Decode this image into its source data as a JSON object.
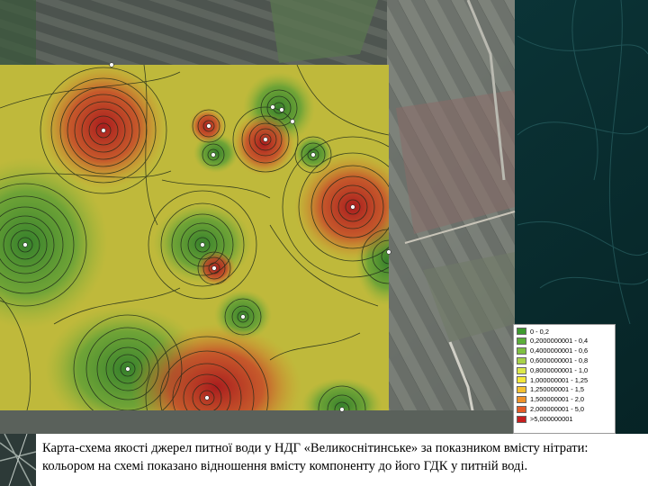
{
  "legend": {
    "items": [
      {
        "label": "0 - 0,2",
        "color": "#3e9b2f"
      },
      {
        "label": "0,2000000001 - 0,4",
        "color": "#5cae3a"
      },
      {
        "label": "0,4000000001 - 0,6",
        "color": "#7fc042"
      },
      {
        "label": "0,6000000001 - 0,8",
        "color": "#a8d24a"
      },
      {
        "label": "0,8000000001 - 1,0",
        "color": "#dce84c"
      },
      {
        "label": "1,000000001 - 1,25",
        "color": "#f5e83c"
      },
      {
        "label": "1,250000001 - 1,5",
        "color": "#f6c232"
      },
      {
        "label": "1,500000001 - 2,0",
        "color": "#f0922a"
      },
      {
        "label": "2,000000001 - 5,0",
        "color": "#e45a26"
      },
      {
        "label": ">5,000000001",
        "color": "#c61e1e"
      }
    ]
  },
  "caption": {
    "line1": "Карта-схема якості джерел питної води у НДГ «Великоснітинське» за показником вмісту нітрати:",
    "line2": "кольором на схемі показано відношення вмісту компоненту до його ГДК у питній воді."
  }
}
